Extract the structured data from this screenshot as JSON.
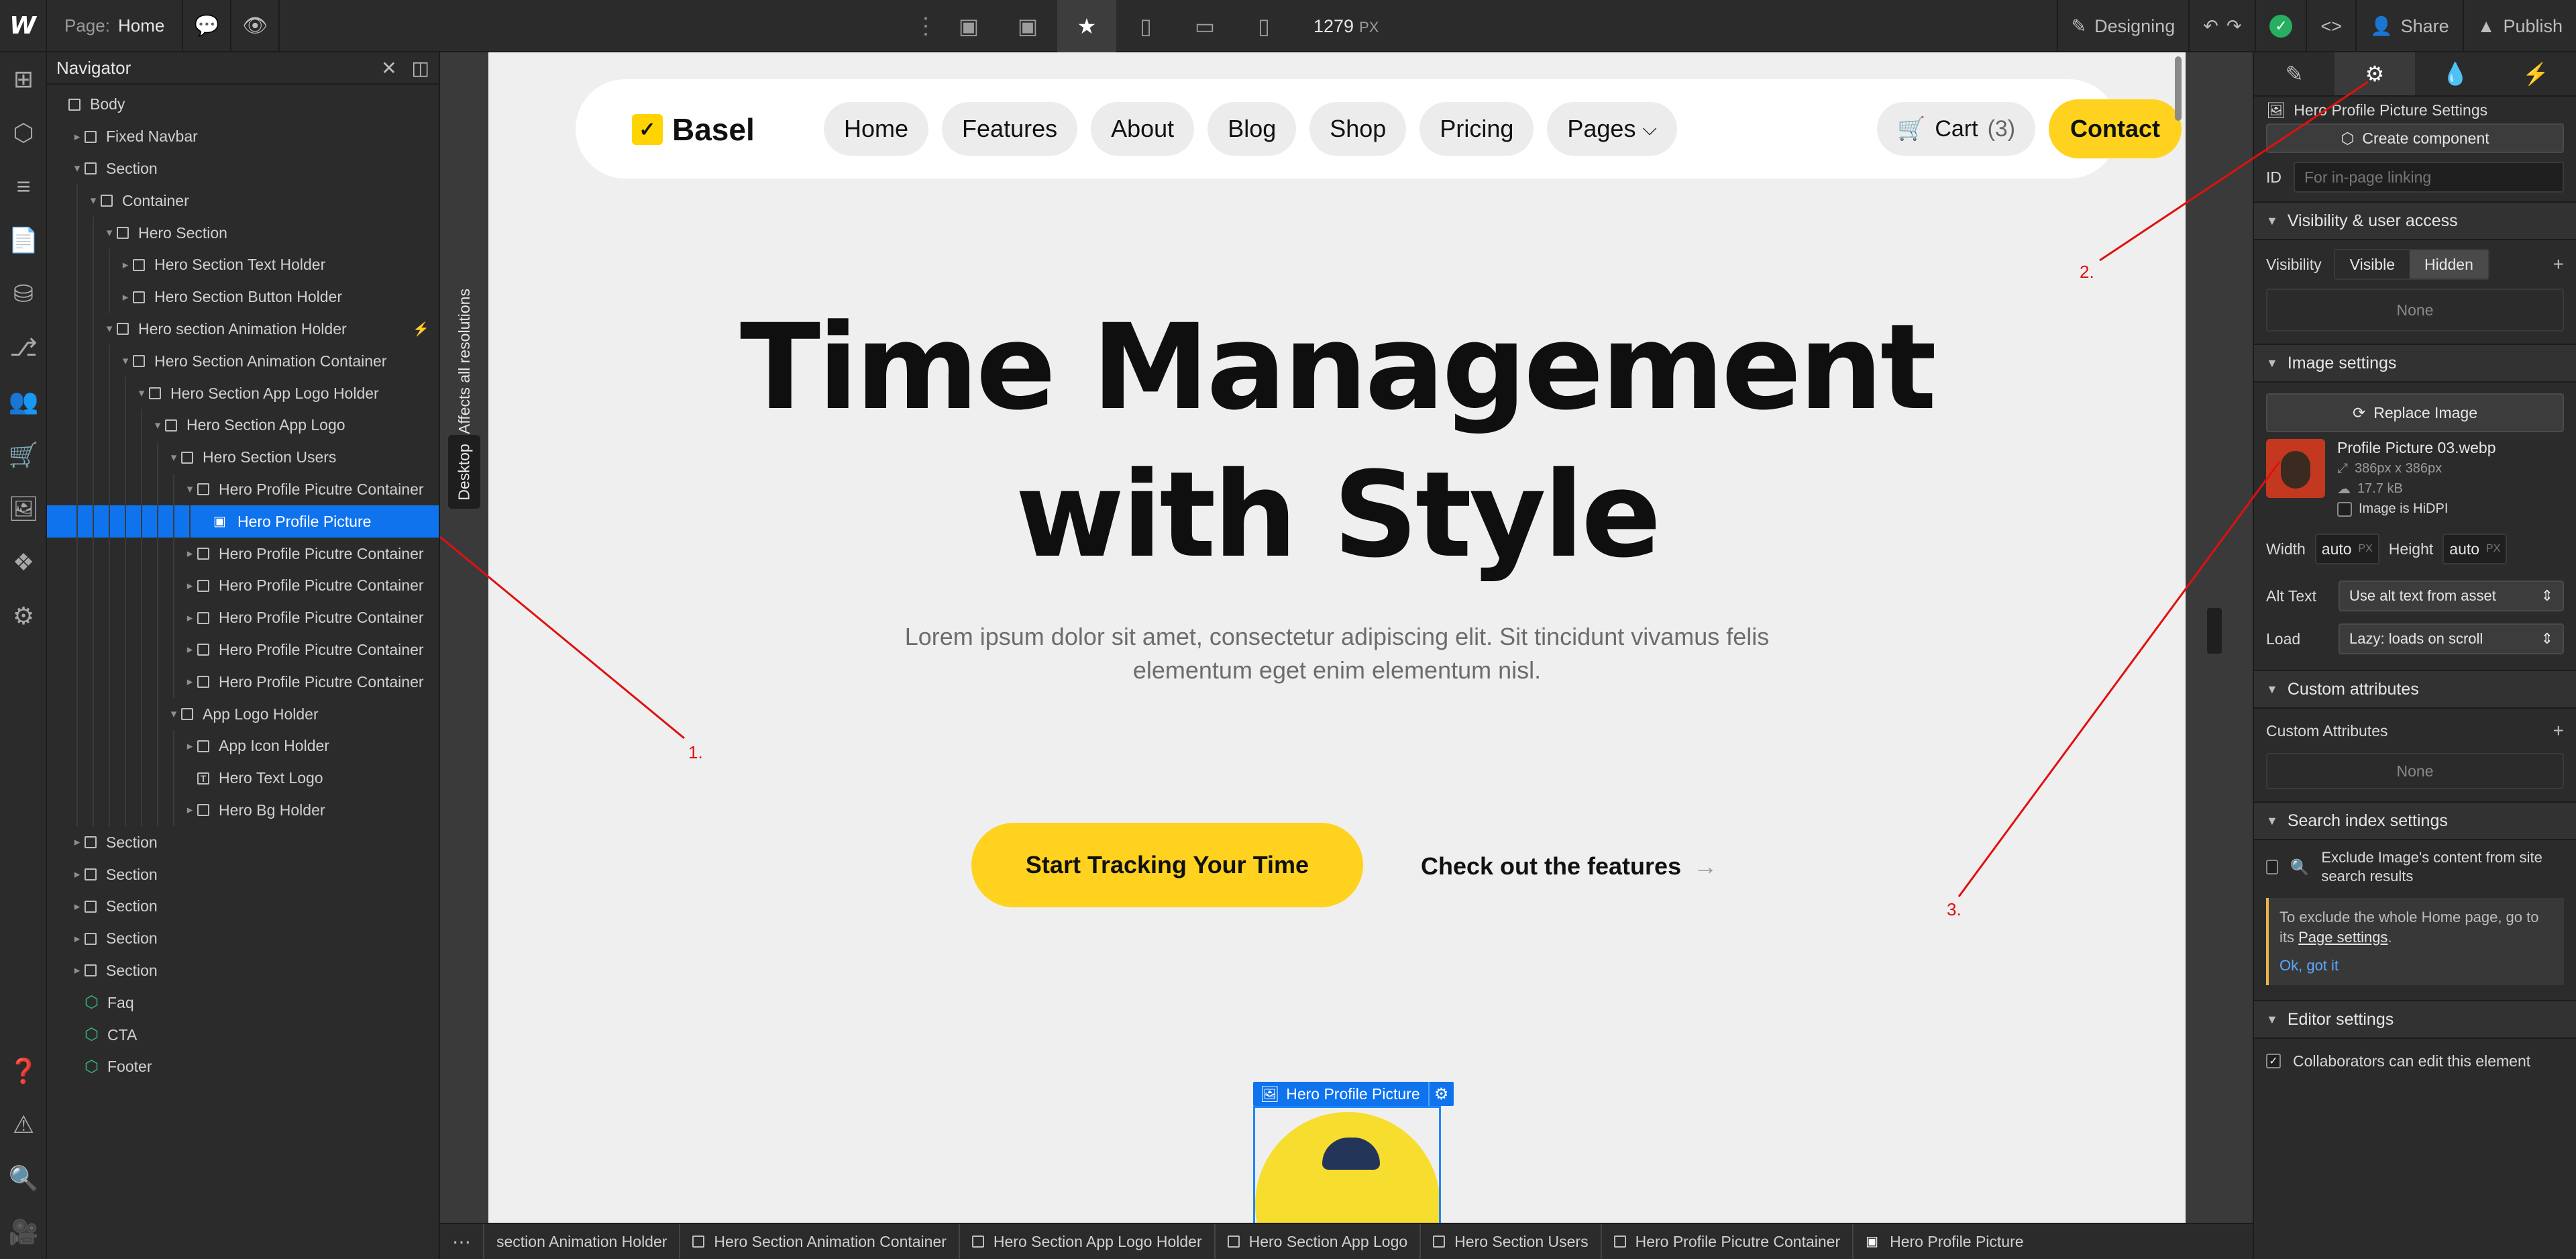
{
  "topbar": {
    "logo": "W",
    "page_label": "Page:",
    "page_name": "Home",
    "width_value": "1279",
    "width_unit": "PX",
    "mode": "Designing",
    "share": "Share",
    "publish": "Publish"
  },
  "navigator": {
    "title": "Navigator",
    "items": [
      {
        "label": "Body",
        "depth": 0,
        "icon": "box",
        "caret": ""
      },
      {
        "label": "Fixed Navbar",
        "depth": 1,
        "icon": "box",
        "caret": "right"
      },
      {
        "label": "Section",
        "depth": 1,
        "icon": "box",
        "caret": "down"
      },
      {
        "label": "Container",
        "depth": 2,
        "icon": "box",
        "caret": "down"
      },
      {
        "label": "Hero Section",
        "depth": 3,
        "icon": "box",
        "caret": "down"
      },
      {
        "label": "Hero Section Text Holder",
        "depth": 4,
        "icon": "box",
        "caret": "right"
      },
      {
        "label": "Hero Section Button Holder",
        "depth": 4,
        "icon": "box",
        "caret": "right"
      },
      {
        "label": "Hero section Animation Holder",
        "depth": 3,
        "icon": "box",
        "caret": "down",
        "bolt": true
      },
      {
        "label": "Hero Section Animation Container",
        "depth": 4,
        "icon": "box",
        "caret": "down"
      },
      {
        "label": "Hero Section App Logo Holder",
        "depth": 5,
        "icon": "box",
        "caret": "down"
      },
      {
        "label": "Hero Section App Logo",
        "depth": 6,
        "icon": "box",
        "caret": "down"
      },
      {
        "label": "Hero Section Users",
        "depth": 7,
        "icon": "box",
        "caret": "down"
      },
      {
        "label": "Hero Profile Picutre Container",
        "depth": 8,
        "icon": "box",
        "caret": "down"
      },
      {
        "label": "Hero Profile Picture",
        "depth": 9,
        "icon": "image",
        "caret": "",
        "selected": true
      },
      {
        "label": "Hero Profile Picutre Container",
        "depth": 8,
        "icon": "box",
        "caret": "right"
      },
      {
        "label": "Hero Profile Picutre Container",
        "depth": 8,
        "icon": "box",
        "caret": "right"
      },
      {
        "label": "Hero Profile Picutre Container",
        "depth": 8,
        "icon": "box",
        "caret": "right"
      },
      {
        "label": "Hero Profile Picutre Container",
        "depth": 8,
        "icon": "box",
        "caret": "right"
      },
      {
        "label": "Hero Profile Picutre Container",
        "depth": 8,
        "icon": "box",
        "caret": "right"
      },
      {
        "label": "App Logo Holder",
        "depth": 7,
        "icon": "box",
        "caret": "down"
      },
      {
        "label": "App Icon Holder",
        "depth": 8,
        "icon": "box",
        "caret": "right"
      },
      {
        "label": "Hero Text Logo",
        "depth": 8,
        "icon": "text",
        "caret": ""
      },
      {
        "label": "Hero Bg Holder",
        "depth": 8,
        "icon": "box",
        "caret": "right"
      },
      {
        "label": "Section",
        "depth": 1,
        "icon": "box",
        "caret": "right"
      },
      {
        "label": "Section",
        "depth": 1,
        "icon": "box",
        "caret": "right"
      },
      {
        "label": "Section",
        "depth": 1,
        "icon": "box",
        "caret": "right"
      },
      {
        "label": "Section",
        "depth": 1,
        "icon": "box",
        "caret": "right"
      },
      {
        "label": "Section",
        "depth": 1,
        "icon": "box",
        "caret": "right"
      },
      {
        "label": "Faq",
        "depth": 1,
        "icon": "component",
        "caret": ""
      },
      {
        "label": "CTA",
        "depth": 1,
        "icon": "component",
        "caret": ""
      },
      {
        "label": "Footer",
        "depth": 1,
        "icon": "component",
        "caret": ""
      }
    ]
  },
  "side_labels": {
    "affects": "Affects all resolutions",
    "desktop": "Desktop"
  },
  "site": {
    "brand": "Basel",
    "nav_links": [
      "Home",
      "Features",
      "About",
      "Blog",
      "Shop",
      "Pricing",
      "Pages"
    ],
    "cart_label": "Cart",
    "cart_count": "(3)",
    "contact": "Contact",
    "hero_line1": "Time Management",
    "hero_line2": "with Style",
    "hero_sub": "Lorem ipsum dolor sit amet, consectetur adipiscing elit. Sit tincidunt vivamus felis elementum eget enim elementum nisl.",
    "cta_primary": "Start Tracking Your Time",
    "cta_secondary": "Check out the features",
    "selected_tag": "Hero Profile Picture"
  },
  "breadcrumb": [
    {
      "label": "section Animation Holder",
      "icon": ""
    },
    {
      "label": "Hero Section Animation Container",
      "icon": "box"
    },
    {
      "label": "Hero Section App Logo Holder",
      "icon": "box"
    },
    {
      "label": "Hero Section App Logo",
      "icon": "box"
    },
    {
      "label": "Hero Section Users",
      "icon": "box"
    },
    {
      "label": "Hero Profile Picutre Container",
      "icon": "box"
    },
    {
      "label": "Hero Profile Picture",
      "icon": "image"
    }
  ],
  "panel": {
    "settings_title": "Hero Profile Picture Settings",
    "create_component": "Create component",
    "id_label": "ID",
    "id_placeholder": "For in-page linking",
    "visibility_section": "Visibility & user access",
    "visibility_label": "Visibility",
    "visible": "Visible",
    "hidden": "Hidden",
    "none": "None",
    "image_section": "Image settings",
    "replace_image": "Replace Image",
    "image_name": "Profile Picture 03.webp",
    "image_dims": "386px x 386px",
    "image_size": "17.7 kB",
    "hidpi": "Image is HiDPI",
    "width_label": "Width",
    "width_value": "auto",
    "height_label": "Height",
    "height_value": "auto",
    "unit": "PX",
    "alt_label": "Alt Text",
    "alt_value": "Use alt text from asset",
    "load_label": "Load",
    "load_value": "Lazy: loads on scroll",
    "custom_attr_section": "Custom attributes",
    "custom_attr_label": "Custom Attributes",
    "custom_none": "None",
    "search_section": "Search index settings",
    "exclude_text": "Exclude Image's content from site search results",
    "info_pre": "To exclude the whole Home page, go to its",
    "info_link": "Page settings",
    "info_post": ".",
    "info_ok": "Ok, got it",
    "editor_section": "Editor settings",
    "collab_text": "Collaborators can edit this element"
  },
  "annotations": [
    "1.",
    "2.",
    "3."
  ],
  "colors": {
    "accent_blue": "#0f73ee",
    "brand_yellow": "#ffd21f",
    "annotation_red": "#e01010"
  }
}
